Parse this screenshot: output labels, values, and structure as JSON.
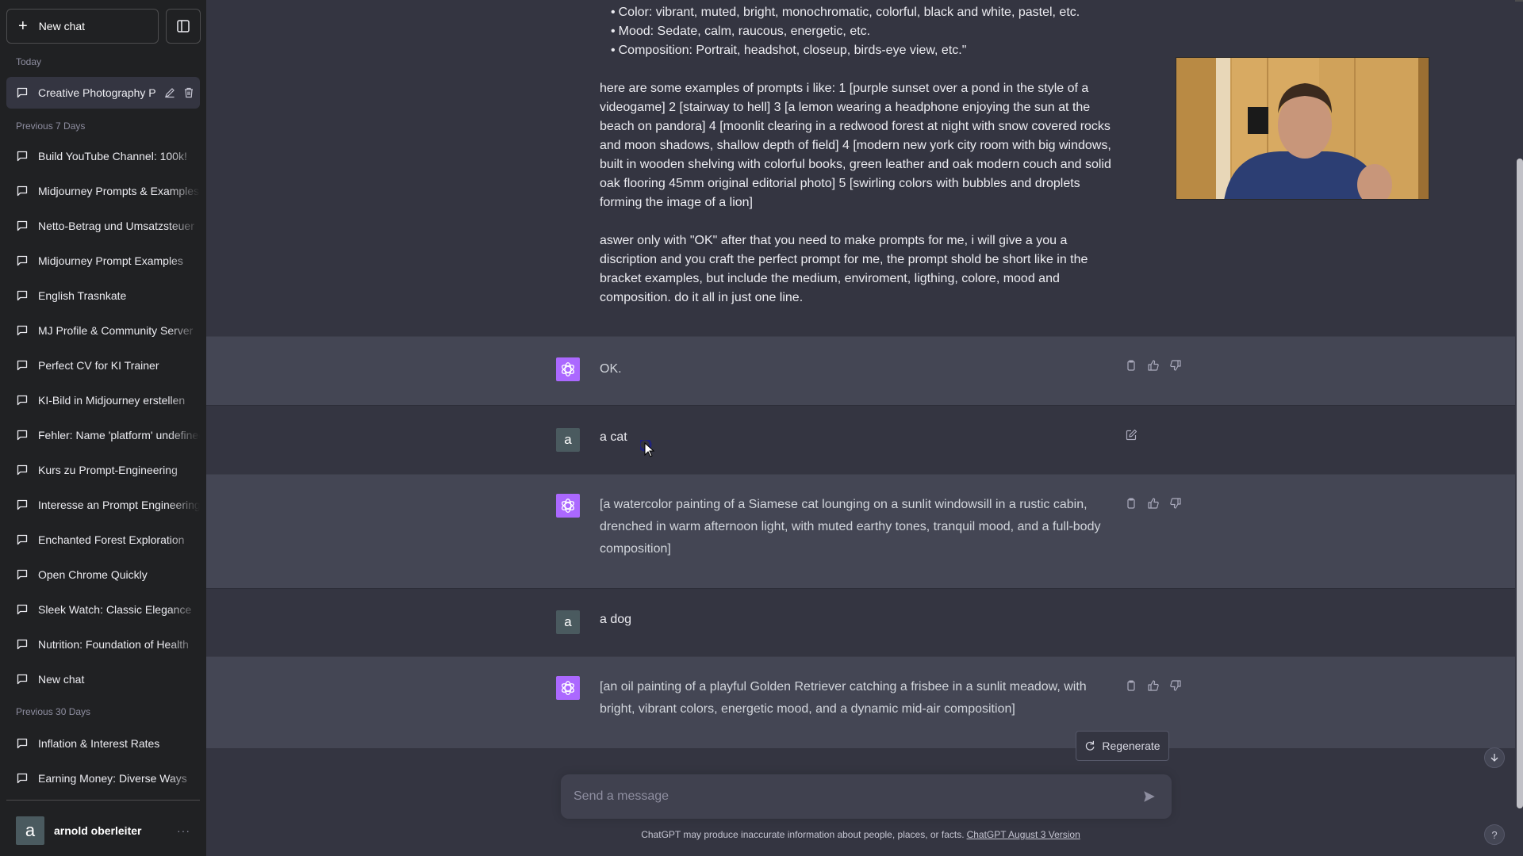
{
  "sidebar": {
    "new_chat_label": "New chat",
    "groups": {
      "today": "Today",
      "prev7": "Previous 7 Days",
      "prev30": "Previous 30 Days"
    },
    "active_item": "Creative Photography P",
    "items_prev7": [
      "Build YouTube Channel: 100k!",
      "Midjourney Prompts & Examples",
      "Netto-Betrag und Umsatzsteuer",
      "Midjourney Prompt Examples",
      "English Trasnkate",
      "MJ Profile & Community Server",
      "Perfect CV for KI Trainer",
      "KI-Bild in Midjourney erstellen",
      "Fehler: Name 'platform' undefined",
      "Kurs zu Prompt-Engineering",
      "Interesse an Prompt Engineering",
      "Enchanted Forest Exploration",
      "Open Chrome Quickly",
      "Sleek Watch: Classic Elegance",
      "Nutrition: Foundation of Health",
      "New chat"
    ],
    "items_prev30": [
      "Inflation & Interest Rates",
      "Earning Money: Diverse Ways"
    ],
    "user": {
      "avatar_letter": "a",
      "name": "arnold oberleiter",
      "more": "···"
    }
  },
  "conversation": {
    "prompt_bullets": [
      "Color: vibrant, muted, bright, monochromatic, colorful, black and white, pastel, etc.",
      "Mood: Sedate, calm, raucous, energetic, etc.",
      "Composition: Portrait, headshot, closeup, birds-eye view, etc.\""
    ],
    "prompt_examples": "here are some examples of prompts i like: 1 [purple sunset over a pond in the style of a videogame] 2 [stairway to hell] 3 [a lemon wearing a headphone enjoying the sun at the beach on pandora] 4 [moonlit clearing in a redwood forest at night with snow covered rocks and moon shadows, shallow depth of field] 4 [modern new york city room with big windows, built in wooden shelving with colorful books, green leather and oak modern couch and solid oak flooring 45mm original editorial photo] 5 [swirling colors with bubbles and droplets forming the image of a lion]",
    "prompt_instruction": "aswer only with \"OK\" after that you need to make prompts for me, i will give a you a discription and you craft the perfect prompt for me, the prompt shold be short like in the bracket examples, but include the medium, enviroment, ligthing, colore, mood and composition. do it all in just one line.",
    "messages": [
      {
        "role": "assistant",
        "text": "OK."
      },
      {
        "role": "user",
        "avatar_letter": "a",
        "text": "a cat"
      },
      {
        "role": "assistant",
        "text": "[a watercolor painting of a Siamese cat lounging on a sunlit windowsill in a rustic cabin, drenched in warm afternoon light, with muted earthy tones, tranquil mood, and a full-body composition]"
      },
      {
        "role": "user",
        "avatar_letter": "a",
        "text": "a dog"
      },
      {
        "role": "assistant",
        "text": "[an oil painting of a playful Golden Retriever catching a frisbee in a sunlit meadow, with bright, vibrant colors, energetic mood, and a dynamic mid-air composition]"
      }
    ]
  },
  "composer": {
    "regenerate_label": "Regenerate",
    "placeholder": "Send a message",
    "value": "",
    "footer_text": "ChatGPT may produce inaccurate information about people, places, or facts.",
    "footer_link": "ChatGPT August 3 Version"
  },
  "help_label": "?",
  "colors": {
    "sidebar_bg": "#202123",
    "main_bg": "#343541",
    "assistant_row_bg": "#444654",
    "assistant_avatar": "#AB68FF",
    "user_avatar": "#4A5A5F"
  }
}
